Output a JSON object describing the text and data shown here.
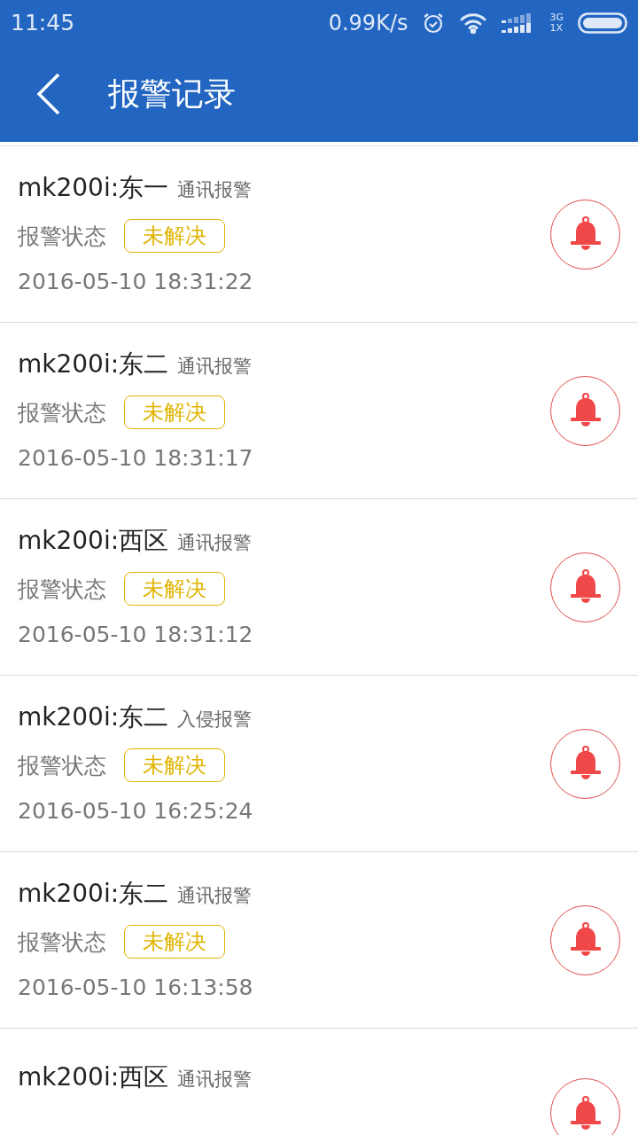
{
  "status_bar": {
    "time": "11:45",
    "speed": "0.99K/s",
    "network_top": "3G",
    "network_bottom": "1X"
  },
  "header": {
    "title": "报警记录"
  },
  "alarms": [
    {
      "device": "mk200i:东一",
      "type": "通讯报警",
      "status_label": "报警状态",
      "status": "未解决",
      "time": "2016-05-10 18:31:22"
    },
    {
      "device": "mk200i:东二",
      "type": "通讯报警",
      "status_label": "报警状态",
      "status": "未解决",
      "time": "2016-05-10 18:31:17"
    },
    {
      "device": "mk200i:西区",
      "type": "通讯报警",
      "status_label": "报警状态",
      "status": "未解决",
      "time": "2016-05-10 18:31:12"
    },
    {
      "device": "mk200i:东二",
      "type": "入侵报警",
      "status_label": "报警状态",
      "status": "未解决",
      "time": "2016-05-10 16:25:24"
    },
    {
      "device": "mk200i:东二",
      "type": "通讯报警",
      "status_label": "报警状态",
      "status": "未解决",
      "time": "2016-05-10 16:13:58"
    },
    {
      "device": "mk200i:西区",
      "type": "通讯报警"
    }
  ]
}
